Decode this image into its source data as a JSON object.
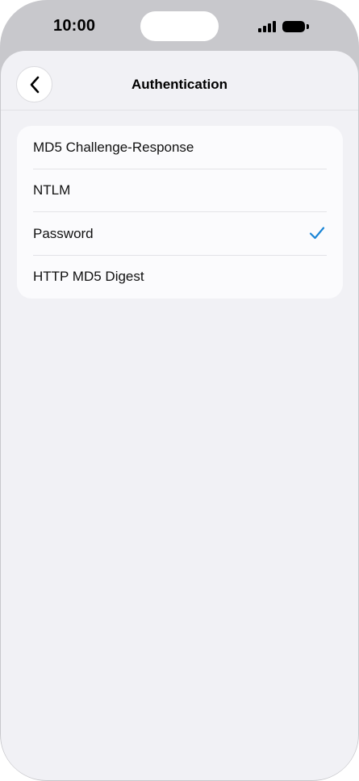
{
  "status_bar": {
    "time": "10:00"
  },
  "nav": {
    "title": "Authentication",
    "back_icon": "chevron-left-icon"
  },
  "options": [
    {
      "label": "MD5 Challenge-Response",
      "selected": false
    },
    {
      "label": "NTLM",
      "selected": false
    },
    {
      "label": "Password",
      "selected": true
    },
    {
      "label": "HTTP MD5 Digest",
      "selected": false
    }
  ],
  "colors": {
    "accent": "#1a85d6",
    "background": "#f1f1f5",
    "card": "#fbfbfd"
  }
}
